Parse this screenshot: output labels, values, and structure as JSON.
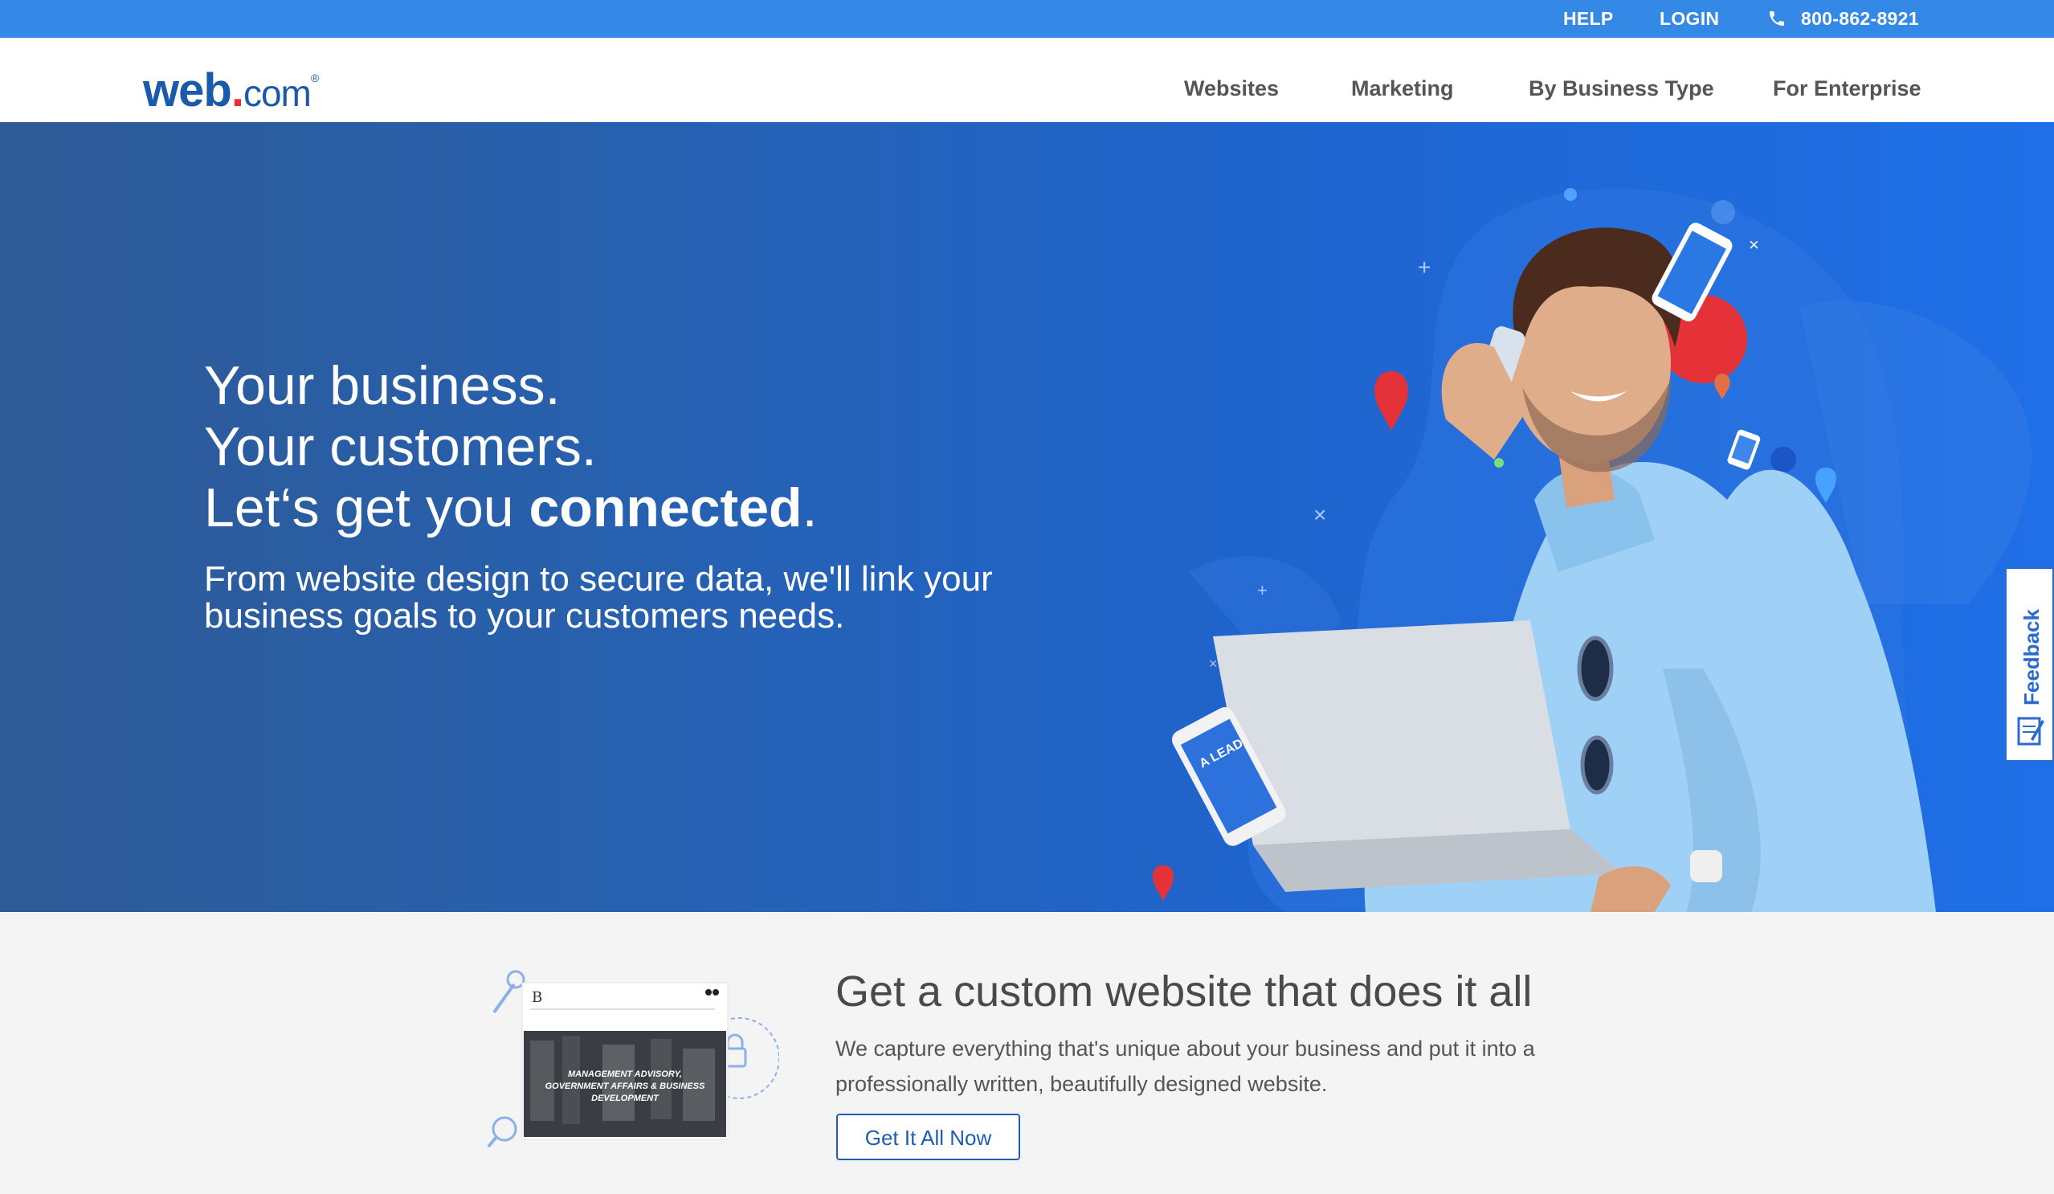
{
  "topbar": {
    "help": "HELP",
    "login": "LOGIN",
    "phone": "800-862-8921",
    "bg": "#3589e6"
  },
  "logo": {
    "web": "web",
    "dot": ".",
    "com": "com",
    "reg": "®"
  },
  "nav": {
    "items": [
      "Websites",
      "Marketing",
      "By Business Type",
      "For Enterprise"
    ]
  },
  "hero": {
    "line1": "Your business.",
    "line2": "Your customers.",
    "line3_pre": "Let‘s get you ",
    "line3_bold": "connected",
    "line3_post": ".",
    "subtitle": "From website design to secure data, we'll link your business goals to your customers needs.",
    "phone_screen_text": "A LEAD"
  },
  "feedback": {
    "label": "Feedback"
  },
  "promo": {
    "title": "Get a custom website that does it all",
    "description": "We capture everything that's unique about your business and put it into a professionally written, beautifully designed website.",
    "button": "Get It All Now",
    "image_caption": "MANAGEMENT ADVISORY, GOVERNMENT AFFAIRS & BUSINESS DEVELOPMENT"
  },
  "colors": {
    "accent": "#1f5cb7",
    "brand_red": "#e3303b"
  }
}
